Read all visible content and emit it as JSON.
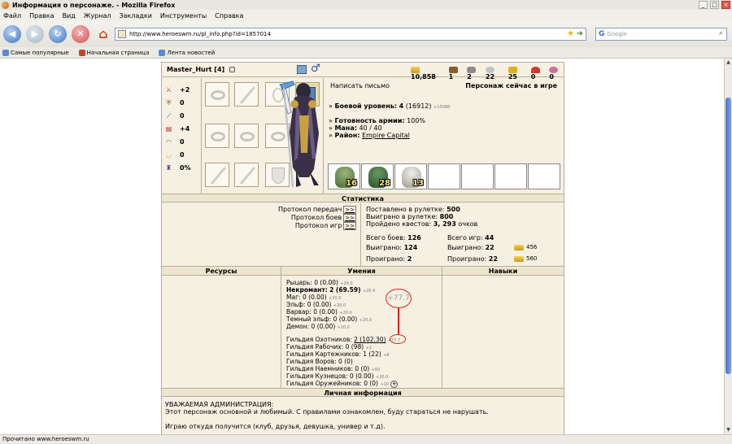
{
  "window": {
    "title": "Информация о персонаже. - Mozilla Firefox"
  },
  "menu": [
    "Файл",
    "Правка",
    "Вид",
    "Журнал",
    "Закладки",
    "Инструменты",
    "Справка"
  ],
  "url": "http://www.heroeswm.ru/pl_info.php?id=1857014",
  "search": {
    "placeholder": "Google"
  },
  "bookmarks": [
    "Самые популярные",
    "Начальная страница",
    "Лента новостей"
  ],
  "status": "Прочитано www.heroeswm.ru",
  "character": {
    "name": "Master_Hurt",
    "level_tag": "[4]",
    "resources": [
      "10,858",
      "1",
      "2",
      "22",
      "25",
      "0",
      "0"
    ],
    "stats": [
      {
        "icon": "attack-icon",
        "value": "+2"
      },
      {
        "icon": "defense-icon",
        "value": "0"
      },
      {
        "icon": "spellpower-icon",
        "value": "0"
      },
      {
        "icon": "knowledge-icon",
        "value": "+4"
      },
      {
        "icon": "luck-icon",
        "value": "0"
      },
      {
        "icon": "morale-icon",
        "value": "0"
      },
      {
        "icon": "resist-icon",
        "value": "0%"
      }
    ],
    "write_letter": "Написать письмо",
    "online_status": "Персонаж сейчас в игре",
    "combat_level_label": "Боевой уровень:",
    "combat_level_value": "4",
    "combat_level_exp": "(16912)",
    "combat_level_next": "+15088",
    "army_ready_label": "Готовность армии:",
    "army_ready_value": "100%",
    "mana_label": "Мана:",
    "mana_value": "40 / 40",
    "district_label": "Район:",
    "district_value": "Empire Capital",
    "army": [
      {
        "count": "16",
        "color": "#6f8a4e"
      },
      {
        "count": "28",
        "color": "#3f6a3c"
      },
      {
        "count": "13",
        "color": "#c8c8c0"
      },
      {
        "count": "",
        "color": ""
      },
      {
        "count": "",
        "color": ""
      },
      {
        "count": "",
        "color": ""
      },
      {
        "count": "",
        "color": ""
      }
    ]
  },
  "statistics": {
    "header": "Статистика",
    "left": [
      {
        "label": "Протокол передач",
        "link": ">>"
      },
      {
        "label": "Протокол боев",
        "link": ">>"
      },
      {
        "label": "Протокол игр",
        "link": ">>"
      }
    ],
    "roulette_bet_label": "Поставлено в рулетке:",
    "roulette_bet_value": "500",
    "roulette_won_label": "Выиграно в рулетке:",
    "roulette_won_value": "800",
    "quests_label": "Пройдено квестов:",
    "quests_value": "3, 293",
    "quests_suffix": "очков",
    "battles_total_label": "Всего боев:",
    "battles_total_value": "126",
    "battles_won_label": "Выиграно:",
    "battles_won_value": "124",
    "battles_lost_label": "Проиграно:",
    "battles_lost_value": "2",
    "games_total_label": "Всего игр:",
    "games_total_value": "44",
    "games_won_label": "Выиграно:",
    "games_won_value": "22",
    "games_lost_label": "Проиграно:",
    "games_lost_value": "22",
    "gold_won": "456",
    "gold_lost": "560"
  },
  "columns": {
    "resources": "Ресурсы",
    "skills": "Умения",
    "talents": "Навыки"
  },
  "skills": [
    {
      "name": "Рыцарь:",
      "value": "0 (0.00)",
      "small": "+20.0",
      "bold": false
    },
    {
      "name": "Некромант:",
      "value": "2 (69.59)",
      "small": "+20.4",
      "bold": true
    },
    {
      "name": "Маг:",
      "value": "0 (0.00)",
      "small": "+20.0",
      "bold": false
    },
    {
      "name": "Эльф:",
      "value": "0 (0.00)",
      "small": "+20.0",
      "bold": false
    },
    {
      "name": "Варвар:",
      "value": "0 (0.00)",
      "small": "+20.0",
      "bold": false
    },
    {
      "name": "Темный эльф:",
      "value": "0 (0.00)",
      "small": "+20.0",
      "bold": false
    },
    {
      "name": "Демон:",
      "value": "0 (0.00)",
      "small": "+20.0",
      "bold": false
    }
  ],
  "guilds": [
    {
      "name": "Гильдия Охотников:",
      "value": "2 (102.30)",
      "small": "+77.7"
    },
    {
      "name": "Гильдия Рабочих:",
      "value": "0 (98)",
      "small": "+2"
    },
    {
      "name": "Гильдия Картежников:",
      "value": "1 (22)",
      "small": "+8"
    },
    {
      "name": "Гильдия Воров:",
      "value": "0 (0)",
      "small": ""
    },
    {
      "name": "Гильдия Наемников:",
      "value": "0 (0)",
      "small": "+50"
    },
    {
      "name": "Гильдия Кузнецов:",
      "value": "0 (0.00)",
      "small": "+30.0"
    },
    {
      "name": "Гильдия Оружейников:",
      "value": "0 (0)",
      "small": "+10"
    }
  ],
  "annotation": "+77.7",
  "personal": {
    "header": "Личная информация",
    "lines": [
      "УВАЖАЕМАЯ АДМИНИСТРАЦИЯ:",
      "Этот персонаж основной и любимый. С правилами ознакомлен, буду стараться не нарушать.",
      "",
      "Играю откуда получится (клуб, друзья, девушка, универ и т.д)."
    ]
  }
}
